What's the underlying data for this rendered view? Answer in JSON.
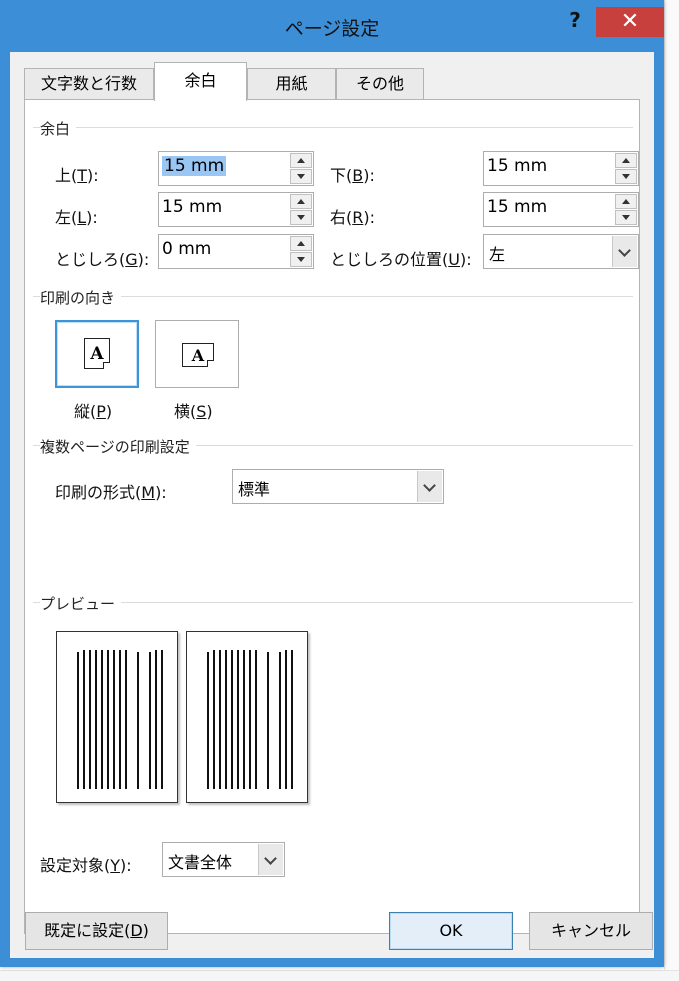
{
  "window": {
    "title": "ページ設定",
    "help_label": "?",
    "close_label": "✕"
  },
  "tabs": [
    {
      "label": "文字数と行数",
      "active": false
    },
    {
      "label": "余白",
      "active": true
    },
    {
      "label": "用紙",
      "active": false
    },
    {
      "label": "その他",
      "active": false
    }
  ],
  "margins": {
    "group_label": "余白",
    "top": {
      "label_pre": "上(",
      "accel": "T",
      "label_post": "):",
      "value": "15 mm"
    },
    "bottom": {
      "label_pre": "下(",
      "accel": "B",
      "label_post": "):",
      "value": "15 mm"
    },
    "left": {
      "label_pre": "左(",
      "accel": "L",
      "label_post": "):",
      "value": "15 mm"
    },
    "right": {
      "label_pre": "右(",
      "accel": "R",
      "label_post": "):",
      "value": "15 mm"
    },
    "gutter": {
      "label_pre": "とじしろ(",
      "accel": "G",
      "label_post": "):",
      "value": "0 mm"
    },
    "gutter_position": {
      "label_pre": "とじしろの位置(",
      "accel": "U",
      "label_post": "):",
      "value": "左"
    }
  },
  "orientation": {
    "group_label": "印刷の向き",
    "icon_letter": "A",
    "portrait": {
      "label_pre": "縦(",
      "accel": "P",
      "label_post": ")",
      "selected": true
    },
    "landscape": {
      "label_pre": "横(",
      "accel": "S",
      "label_post": ")",
      "selected": false
    }
  },
  "multiple_pages": {
    "group_label": "複数ページの印刷設定",
    "format": {
      "label_pre": "印刷の形式(",
      "accel": "M",
      "label_post": "):",
      "value": "標準"
    }
  },
  "preview": {
    "group_label": "プレビュー",
    "apply_to": {
      "label_pre": "設定対象(",
      "accel": "Y",
      "label_post": "):",
      "value": "文書全体"
    }
  },
  "buttons": {
    "set_default": {
      "label_pre": "既定に設定(",
      "accel": "D",
      "label_post": ")"
    },
    "ok": "OK",
    "cancel": "キャンセル"
  },
  "colors": {
    "title_bar": "#3c8fd6",
    "close_button": "#c7403d",
    "selection": "#99c6f3",
    "focus_border": "#3d95d8"
  }
}
